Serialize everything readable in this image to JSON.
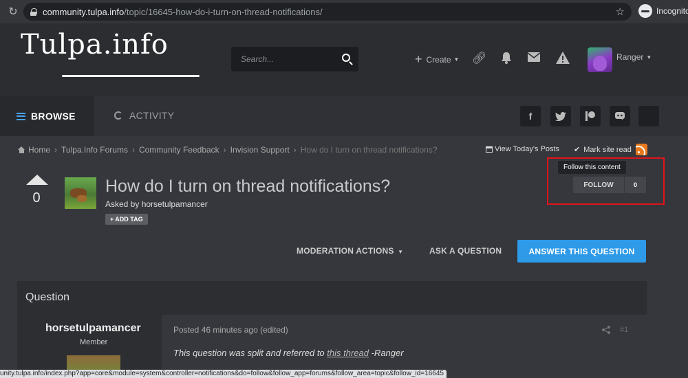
{
  "browser": {
    "url_host": "community.tulpa.info",
    "url_path": "/topic/16645-how-do-i-turn-on-thread-notifications/",
    "incognito_label": "Incognito",
    "status_url": "unity.tulpa.info/index.php?app=core&module=system&controller=notifications&do=follow&follow_app=forums&follow_area=topic&follow_id=16645"
  },
  "header": {
    "logo_text": "Tulpa.info",
    "search_placeholder": "Search...",
    "create_label": "Create",
    "username": "Ranger"
  },
  "nav": {
    "browse_label": "BROWSE",
    "activity_label": "ACTIVITY",
    "social_icons": [
      "facebook-icon",
      "twitter-icon",
      "patreon-icon",
      "discord-icon",
      "blank-icon"
    ]
  },
  "breadcrumb": {
    "items": [
      "Home",
      "Tulpa.Info Forums",
      "Community Feedback",
      "Invision Support"
    ],
    "current": "How do I turn on thread notifications?"
  },
  "links": {
    "view_todays_posts": "View Today's Posts",
    "mark_site_read": "Mark site read"
  },
  "topic": {
    "vote_count": "0",
    "title": "How do I turn on thread notifications?",
    "asked_by": "Asked by horsetulpamancer",
    "add_tag_label": "ADD TAG"
  },
  "follow": {
    "tooltip": "Follow this content",
    "label": "FOLLOW",
    "count": "0"
  },
  "actions": {
    "moderation_label": "MODERATION ACTIONS",
    "ask_label": "ASK A QUESTION",
    "answer_label": "ANSWER THIS QUESTION"
  },
  "question": {
    "section_title": "Question",
    "author_name": "horsetulpamancer",
    "author_role": "Member",
    "posted": "Posted 46 minutes ago (edited)",
    "post_number": "#1",
    "body_before": "This question was split and referred to ",
    "body_link": "this thread",
    "body_after": " -Ranger"
  },
  "colors": {
    "accent_blue": "#2e9ae8",
    "highlight_red": "#e0141b",
    "rss_orange": "#e87a1f"
  }
}
